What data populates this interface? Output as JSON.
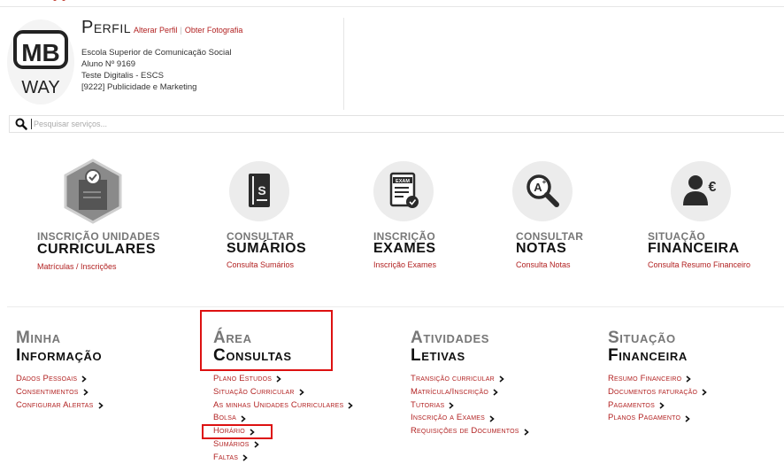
{
  "profile": {
    "title": "Perfil",
    "alter_link": "Alterar Perfil",
    "separator": "|",
    "photo_link": "Obter Fotografia",
    "lines": [
      "Escola Superior de Comunicação Social",
      "Aluno Nº 9169",
      "Teste Digitalis - ESCS",
      "[9222] Publicidade e Marketing"
    ],
    "avatar_logo_top": "MB",
    "avatar_logo_bottom": "WAY"
  },
  "search": {
    "placeholder": "Pesquisar serviços..."
  },
  "tiles": [
    {
      "line1": "INSCRIÇÃO UNIDADES",
      "line2": "CURRICULARES",
      "link": "Matrículas / Inscrições",
      "icon": "document-check-hexagon-icon"
    },
    {
      "line1": "CONSULTAR",
      "line2": "SUMÁRIOS",
      "link": "Consulta Sumários",
      "icon": "book-icon"
    },
    {
      "line1": "INSCRIÇÃO",
      "line2": "EXAMES",
      "link": "Inscrição Exames",
      "icon": "exam-sheet-icon"
    },
    {
      "line1": "CONSULTAR",
      "line2": "NOTAS",
      "link": "Consulta Notas",
      "icon": "magnifier-grade-icon"
    },
    {
      "line1": "SITUAÇÃO",
      "line2": "FINANCEIRA",
      "link": "Consulta Resumo Financeiro",
      "icon": "person-euro-icon"
    }
  ],
  "menus": [
    {
      "h1": "Minha",
      "h2": "Informação",
      "items": [
        "Dados Pessoais",
        "Consentimentos",
        "Configurar Alertas"
      ]
    },
    {
      "h1": "Área",
      "h2": "Consultas",
      "items": [
        "Plano Estudos",
        "Situação Curricular",
        "As minhas Unidades Curriculares",
        "Bolsa",
        "Horário",
        "Sumários",
        "Faltas"
      ]
    },
    {
      "h1": "Atividades",
      "h2": "Letivas",
      "items": [
        "Transição curricular",
        "Matrícula/Inscrição",
        "Tutorias",
        "Inscrição a Exames",
        "Requisições de Documentos"
      ]
    },
    {
      "h1": "Situação",
      "h2": "Financeira",
      "items": [
        "Resumo Financeiro",
        "Documentos faturação",
        "Pagamentos",
        "Planos Pagamento"
      ]
    }
  ],
  "colors": {
    "accent": "#b22222",
    "highlight": "#dd1111"
  }
}
